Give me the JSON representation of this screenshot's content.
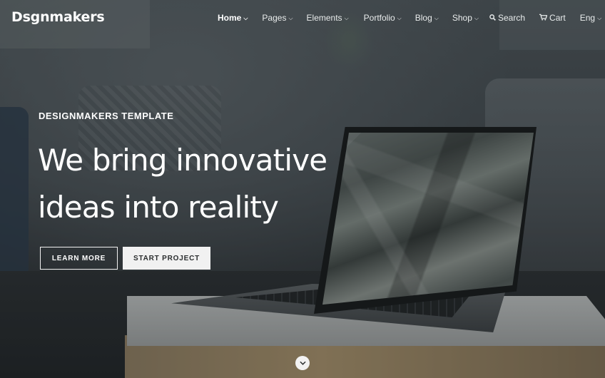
{
  "header": {
    "logo": "Dsgnmakers",
    "nav": [
      {
        "label": "Home",
        "active": true
      },
      {
        "label": "Pages"
      },
      {
        "label": "Elements"
      },
      {
        "label": "Portfolio"
      },
      {
        "label": "Blog"
      },
      {
        "label": "Shop"
      }
    ],
    "search_label": "Search",
    "cart_label": "Cart",
    "lang_label": "Eng"
  },
  "hero": {
    "eyebrow": "DESIGNMAKERS TEMPLATE",
    "headline_line1": "We bring innovative",
    "headline_line2": "ideas into reality",
    "learn_more": "LEARN MORE",
    "start_project": "START PROJECT"
  },
  "icons": {
    "chevron": "chevron-down-icon",
    "search": "search-icon",
    "cart": "cart-icon",
    "scroll": "chevron-down-icon"
  },
  "colors": {
    "text": "#ffffff",
    "button_fill": "#f1f1f1",
    "button_text": "#2a2d2e"
  }
}
